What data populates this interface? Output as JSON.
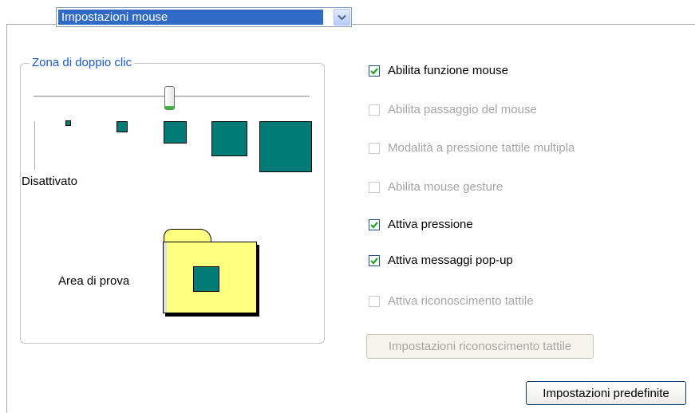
{
  "dropdown": {
    "value": "Impostazioni mouse"
  },
  "zone": {
    "legend": "Zona di doppio clic",
    "slider_level": 0.5,
    "off_label": "Disattivato",
    "test_area_label": "Area di prova"
  },
  "options": [
    {
      "label": "Abilita funzione mouse",
      "checked": true,
      "enabled": true
    },
    {
      "label": "Abilita passaggio del mouse",
      "checked": false,
      "enabled": false
    },
    {
      "label": "Modalità a pressione tattile multipla",
      "checked": false,
      "enabled": false
    },
    {
      "label": "Abilita mouse gesture",
      "checked": false,
      "enabled": false
    },
    {
      "label": "Attiva pressione",
      "checked": true,
      "enabled": true
    },
    {
      "label": "Attiva messaggi pop-up",
      "checked": true,
      "enabled": true
    },
    {
      "label": "Attiva riconoscimento tattile",
      "checked": false,
      "enabled": false
    }
  ],
  "buttons": {
    "recognition_settings": "Impostazioni riconoscimento tattile",
    "defaults": "Impostazioni predefinite"
  },
  "colors": {
    "accent": "#316ac5",
    "legend": "#1b5ac8",
    "square": "#007b76",
    "folder": "#ffff80"
  }
}
